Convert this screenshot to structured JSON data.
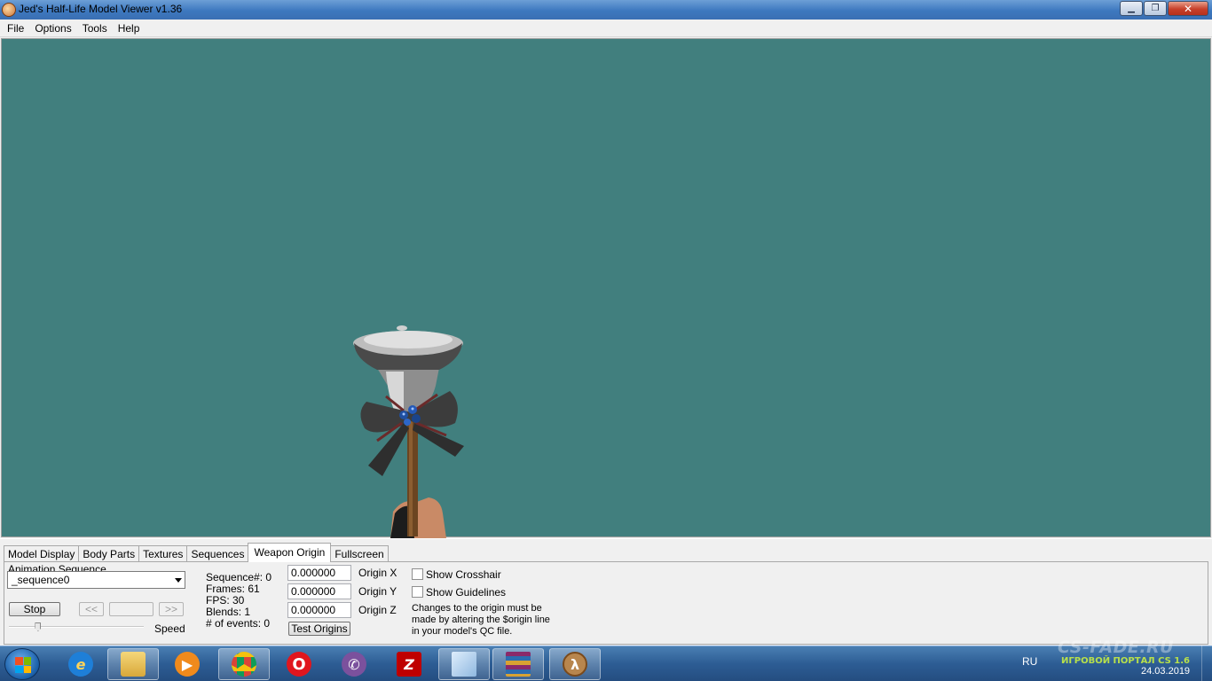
{
  "window": {
    "title": "Jed's Half-Life Model Viewer v1.36",
    "controls": {
      "minimize": "▁",
      "maximize": "❐",
      "close": "✕"
    }
  },
  "menu": [
    "File",
    "Options",
    "Tools",
    "Help"
  ],
  "viewport": {
    "background": "#417f7e"
  },
  "tabs": [
    "Model Display",
    "Body Parts",
    "Textures",
    "Sequences",
    "Weapon Origin",
    "Fullscreen"
  ],
  "active_tab": "Weapon Origin",
  "animation": {
    "label": "Animation Sequence",
    "selected": "_sequence0",
    "stop_label": "Stop",
    "prev_label": "<<",
    "next_label": ">>",
    "speed_label": "Speed",
    "speed_level": 0.22
  },
  "sequence_info": {
    "sequence": "Sequence#: 0",
    "frames": "Frames: 61",
    "fps": "FPS: 30",
    "blends": "Blends: 1",
    "events": "# of events: 0"
  },
  "origin": {
    "x_value": "0.000000",
    "y_value": "0.000000",
    "z_value": "0.000000",
    "x_label": "Origin X",
    "y_label": "Origin Y",
    "z_label": "Origin Z",
    "test_label": "Test Origins"
  },
  "options": {
    "crosshair_label": "Show Crosshair",
    "guidelines_label": "Show Guidelines",
    "note_line1": "Changes to the origin must be",
    "note_line2": "made by altering the $origin line",
    "note_line3": "in your model's QC file."
  },
  "taskbar": {
    "apps": [
      "windows-explorer-ie",
      "file-explorer",
      "media-player",
      "chrome",
      "opera",
      "viber",
      "filezilla",
      "notepad",
      "winrar",
      "half-life-model-viewer"
    ],
    "lang": "RU",
    "watermark_title": "CS-FADE.RU",
    "watermark_subtitle": "ИГРОВОЙ ПОРТАЛ CS 1.6",
    "date": "24.03.2019"
  }
}
